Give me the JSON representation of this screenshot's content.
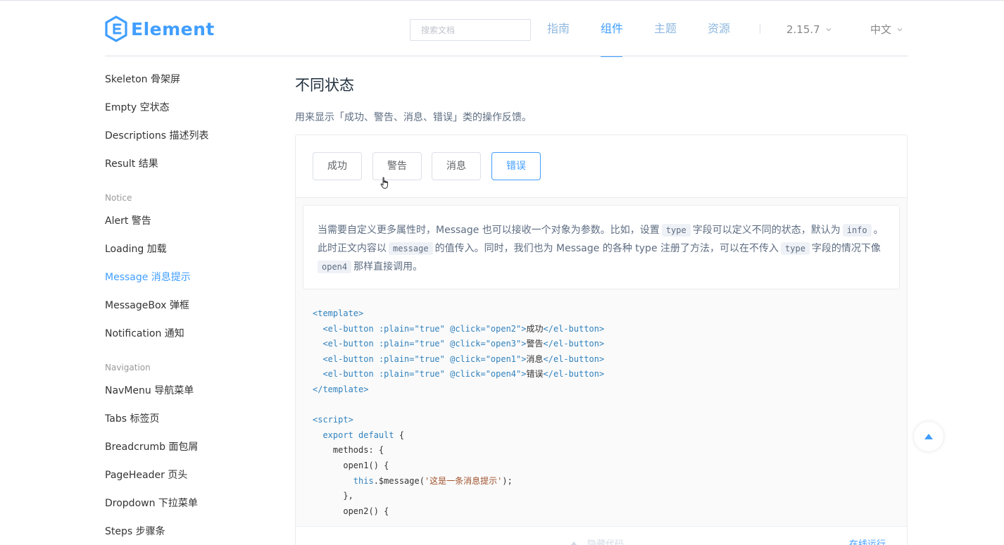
{
  "header": {
    "logo_text": "Element",
    "search_placeholder": "搜索文档",
    "nav": [
      "指南",
      "组件",
      "主题",
      "资源"
    ],
    "active_nav": "组件",
    "version": "2.15.7",
    "language": "中文",
    "brand_color": "#409eff"
  },
  "sidebar": {
    "items_top": [
      "Skeleton 骨架屏",
      "Empty 空状态",
      "Descriptions 描述列表",
      "Result 结果"
    ],
    "group_notice": "Notice",
    "items_notice": [
      "Alert 警告",
      "Loading 加载",
      "Message 消息提示",
      "MessageBox 弹框",
      "Notification 通知"
    ],
    "active_item": "Message 消息提示",
    "group_navigation": "Navigation",
    "items_navigation": [
      "NavMenu 导航菜单",
      "Tabs 标签页",
      "Breadcrumb 面包屑",
      "PageHeader 页头",
      "Dropdown 下拉菜单",
      "Steps 步骤条"
    ]
  },
  "main": {
    "title": "不同状态",
    "description": "用来显示「成功、警告、消息、错误」类的操作反馈。",
    "buttons": [
      "成功",
      "警告",
      "消息",
      "错误"
    ],
    "focused_button": "错误",
    "desc": {
      "p1": "当需要自定义更多属性时，Message 也可以接收一个对象为参数。比如，设置",
      "c1": "type",
      "p2": "字段可以定义不同的状态，默认为",
      "c2": "info",
      "p3": "。",
      "p4": "此时正文内容以",
      "c3": "message",
      "p5": "的值传入。同时，我们也为 Message 的各种 type 注册了方法，可以在不传入",
      "c4": "type",
      "p6": "字段的情况下像",
      "c5": "open4",
      "p7": "那样直接调用。"
    },
    "code": {
      "template_open": "<template>",
      "buttons": [
        {
          "click": "\"open2\"",
          "label": "成功"
        },
        {
          "click": "\"open3\"",
          "label": "警告"
        },
        {
          "click": "\"open1\"",
          "label": "消息"
        },
        {
          "click": "\"open4\"",
          "label": "错误"
        }
      ],
      "el_open": "<el-button",
      "plain_attr": ":plain=",
      "plain_val": "\"true\"",
      "click_attr": "@click=",
      "gt": ">",
      "el_close": "</el-button>",
      "template_close": "</template>",
      "script_open": "<script>",
      "export_kw": "export default",
      "export_brace": " {",
      "methods": "methods: {",
      "open1": "open1() {",
      "this_kw": "this",
      "msg_call_a": ".$message(",
      "msg_str": "'这是一条消息提示'",
      "msg_call_b": ");",
      "close_brace": "},",
      "open2": "open2() {"
    },
    "hide_code": "隐藏代码",
    "run_online": "在线运行"
  }
}
